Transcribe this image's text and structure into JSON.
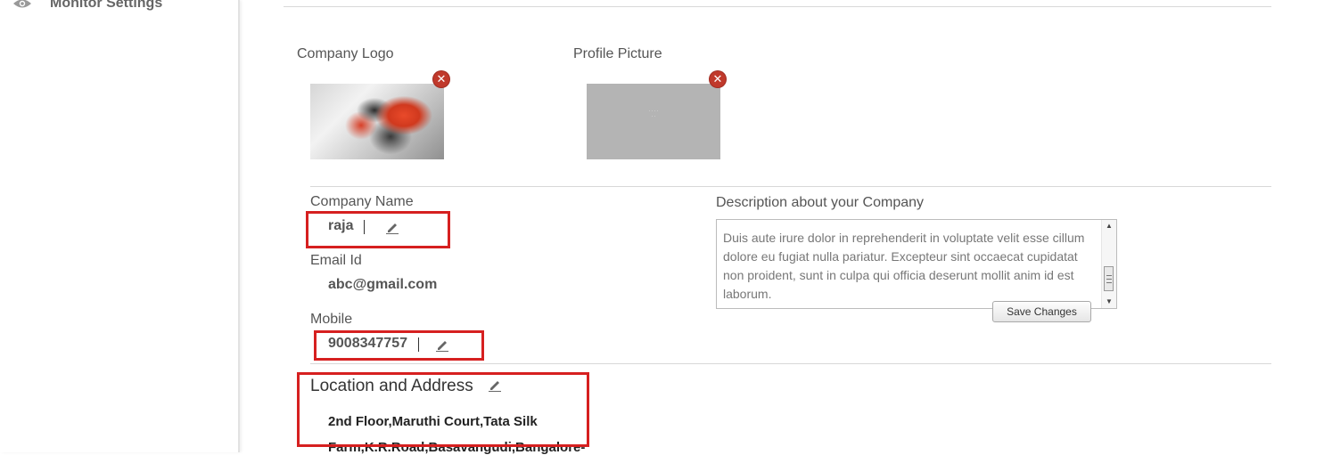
{
  "sidebar": {
    "items": [
      {
        "label": "Monitor Settings",
        "icon": "eye-icon"
      }
    ]
  },
  "media": {
    "company_logo": {
      "label": "Company Logo",
      "icon": "delete-icon"
    },
    "profile_picture": {
      "label": "Profile Picture",
      "icon": "delete-icon"
    }
  },
  "profile": {
    "company_name": {
      "label": "Company Name",
      "value": "raja"
    },
    "email": {
      "label": "Email Id",
      "value": "abc@gmail.com"
    },
    "mobile": {
      "label": "Mobile",
      "value": "9008347757"
    }
  },
  "description": {
    "label": "Description about your Company",
    "text": "Duis aute irure dolor in reprehenderit in voluptate velit esse cillum dolore eu fugiat nulla pariatur. Excepteur sint occaecat cupidatat non proident, sunt in culpa qui officia deserunt mollit anim id est laborum.",
    "save_label": "Save Changes"
  },
  "location": {
    "title": "Location and Address",
    "line1": "2nd Floor,Maruthi Court,Tata Silk",
    "line2": "Farm,K.R.Road,Basavangudi,Bangalore-"
  },
  "colors": {
    "highlight": "#d62020",
    "delete": "#c0392b"
  }
}
